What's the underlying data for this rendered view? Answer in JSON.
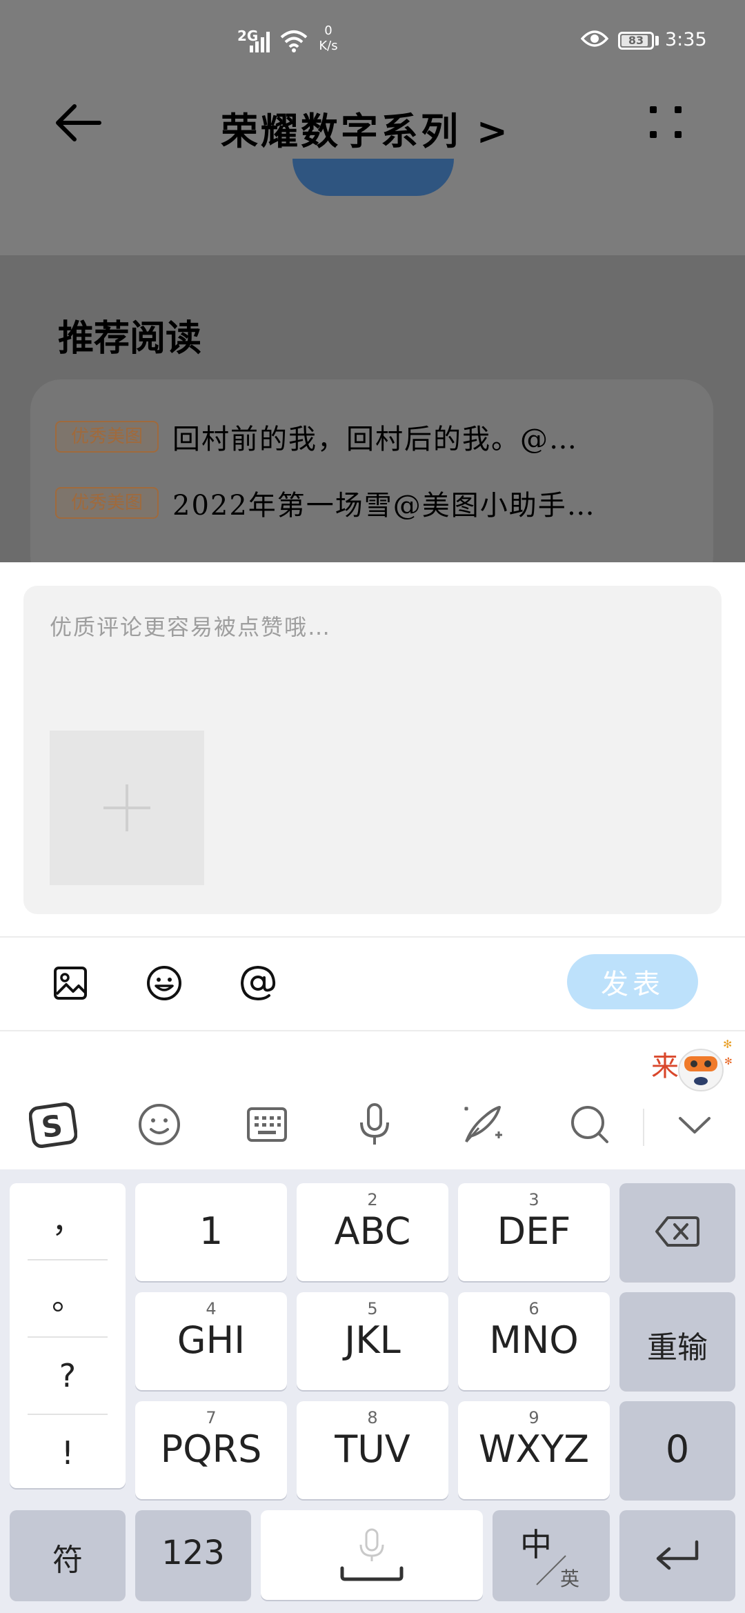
{
  "status_bar": {
    "network": "2G",
    "speed_value": "0",
    "speed_unit": "K/s",
    "battery": "83",
    "time": "3:35"
  },
  "nav": {
    "title": "荣耀数字系列 >"
  },
  "recommended": {
    "title": "推荐阅读",
    "items": [
      {
        "tag": "优秀美图",
        "text": "回村前的我，回村后的我。@…"
      },
      {
        "tag": "优秀美图",
        "text": "2022年第一场雪@美图小助手…"
      }
    ]
  },
  "comment": {
    "placeholder": "优质评论更容易被点赞哦…",
    "publish_label": "发表",
    "toolbar_icons": [
      "image-icon",
      "emoji-icon",
      "at-icon"
    ]
  },
  "ime_toolbar": [
    "sogou-logo-icon",
    "emoji-icon",
    "keyboard-icon",
    "microphone-icon",
    "handwriting-icon",
    "search-icon",
    "collapse-icon"
  ],
  "keyboard": {
    "punctuation": [
      "，",
      "。",
      "?",
      "!"
    ],
    "keys": [
      {
        "main": "1",
        "num": ""
      },
      {
        "main": "ABC",
        "num": "2"
      },
      {
        "main": "DEF",
        "num": "3"
      },
      {
        "main": "GHI",
        "num": "4"
      },
      {
        "main": "JKL",
        "num": "5"
      },
      {
        "main": "MNO",
        "num": "6"
      },
      {
        "main": "PQRS",
        "num": "7"
      },
      {
        "main": "TUV",
        "num": "8"
      },
      {
        "main": "WXYZ",
        "num": "9"
      }
    ],
    "reset_label": "重输",
    "zero_label": "0",
    "symbol_label": "符",
    "numeric_label": "123",
    "lang_main": "中",
    "lang_sub": "英"
  },
  "colors": {
    "publish_bg": "#bde1fb",
    "tag_color": "#a06a3c"
  }
}
